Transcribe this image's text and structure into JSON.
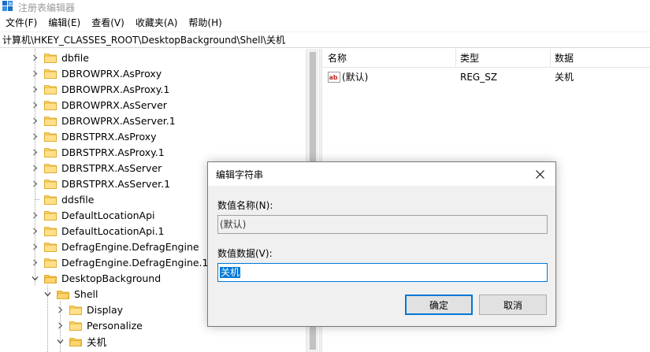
{
  "window": {
    "title": "注册表编辑器"
  },
  "menu": [
    {
      "label": "文件(F)"
    },
    {
      "label": "编辑(E)"
    },
    {
      "label": "查看(V)"
    },
    {
      "label": "收藏夹(A)"
    },
    {
      "label": "帮助(H)"
    }
  ],
  "address": "计算机\\HKEY_CLASSES_ROOT\\DesktopBackground\\Shell\\关机",
  "tree": [
    {
      "label": "dbfile",
      "expander": "collapsed"
    },
    {
      "label": "DBROWPRX.AsProxy",
      "expander": "collapsed"
    },
    {
      "label": "DBROWPRX.AsProxy.1",
      "expander": "collapsed"
    },
    {
      "label": "DBROWPRX.AsServer",
      "expander": "collapsed"
    },
    {
      "label": "DBROWPRX.AsServer.1",
      "expander": "collapsed"
    },
    {
      "label": "DBRSTPRX.AsProxy",
      "expander": "collapsed"
    },
    {
      "label": "DBRSTPRX.AsProxy.1",
      "expander": "collapsed"
    },
    {
      "label": "DBRSTPRX.AsServer",
      "expander": "collapsed"
    },
    {
      "label": "DBRSTPRX.AsServer.1",
      "expander": "collapsed"
    },
    {
      "label": "ddsfile",
      "expander": "none"
    },
    {
      "label": "DefaultLocationApi",
      "expander": "collapsed"
    },
    {
      "label": "DefaultLocationApi.1",
      "expander": "collapsed"
    },
    {
      "label": "DefragEngine.DefragEngine",
      "expander": "collapsed"
    },
    {
      "label": "DefragEngine.DefragEngine.1",
      "expander": "collapsed"
    },
    {
      "label": "DesktopBackground",
      "expander": "expanded"
    },
    {
      "label": "Shell",
      "expander": "expanded"
    },
    {
      "label": "Display",
      "expander": "collapsed"
    },
    {
      "label": "Personalize",
      "expander": "collapsed"
    },
    {
      "label": "关机",
      "expander": "expanded",
      "selected": true
    }
  ],
  "list": {
    "columns": [
      {
        "label": "名称"
      },
      {
        "label": "类型"
      },
      {
        "label": "数据"
      }
    ],
    "rows": [
      {
        "name": "(默认)",
        "type": "REG_SZ",
        "data": "关机",
        "icon": "string-value-icon"
      }
    ]
  },
  "dialog": {
    "title": "编辑字符串",
    "name_label": "数值名称(N):",
    "name_value": "(默认)",
    "data_label": "数值数据(V):",
    "data_value": "关机",
    "ok_label": "确定",
    "cancel_label": "取消"
  },
  "colors": {
    "accent": "#0078d7",
    "folder": "#ffd36e",
    "dialog_bg": "#f0f0f0",
    "title_text": "#9a9a9a"
  }
}
